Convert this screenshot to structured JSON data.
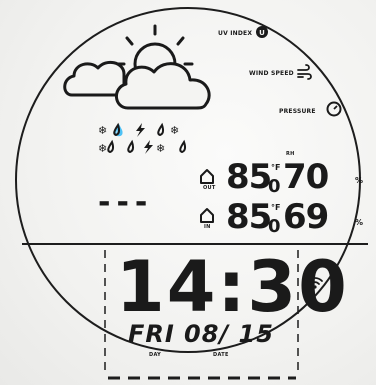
{
  "indicators": {
    "uv_index": "UV INDEX",
    "wind_speed": "WIND SPEED",
    "pressure": "PRESSURE"
  },
  "outdoor": {
    "label": "OUT",
    "temperature": "85",
    "temperature_decimal": "0",
    "temperature_unit": "°F",
    "humidity": "70",
    "humidity_unit": "%",
    "rh_label": "RH"
  },
  "indoor": {
    "label": "IN",
    "temperature": "85",
    "temperature_decimal": "0",
    "temperature_unit": "°F",
    "humidity": "69",
    "humidity_unit": "%"
  },
  "dashes": "---",
  "clock": {
    "time": "14:30",
    "day": "FRI",
    "date": "08/ 15",
    "day_label": "DAY",
    "date_label": "DATE"
  },
  "icons": {
    "weather": "partly-cloudy-icon",
    "precip": "storm-snow-rain-icon",
    "house_out": "house-icon",
    "house_in": "house-icon",
    "wifi": "wifi-icon",
    "uv": "uv-icon",
    "wind": "wind-icon",
    "pressure": "pressure-gauge-icon"
  }
}
